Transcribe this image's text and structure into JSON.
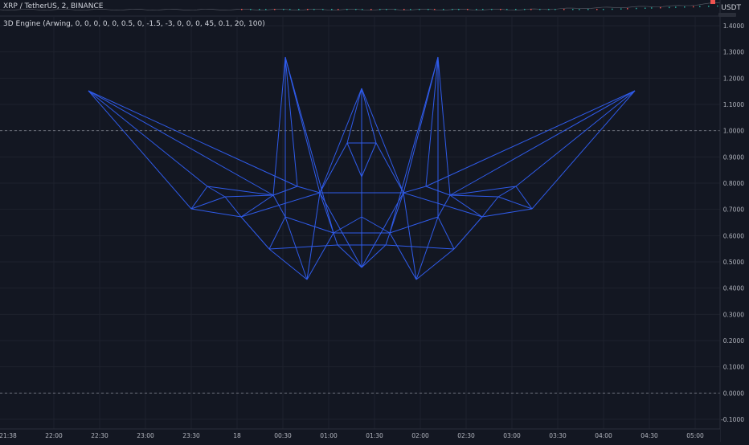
{
  "header": {
    "symbol_title": "XRP / TetherUS, 2, BINANCE",
    "unit": "USDT"
  },
  "indicator": {
    "title": "3D Engine (Arwing, 0, 0, 0, 0, 0, 0.5, 0, -1.5, -3, 0, 0, 0, 45, 0.1, 20, 100)"
  },
  "colors": {
    "background": "#131722",
    "grid": "#1e222d",
    "wireframe": "#2f5bea",
    "dashed_line": "#787b86",
    "axis_text": "#b2b5be",
    "mini_up": "#26a69a",
    "mini_down": "#ef5350"
  },
  "chart_data": {
    "type": "line",
    "y_axis_ticks": [
      "1.4000",
      "1.3000",
      "1.2000",
      "1.1000",
      "1.0000",
      "0.9000",
      "0.8000",
      "0.7000",
      "0.6000",
      "0.5000",
      "0.4000",
      "0.3000",
      "0.2000",
      "0.1000",
      "0.0000",
      "-0.1000"
    ],
    "ylim": [
      -0.1,
      1.4
    ],
    "x_axis_ticks": [
      "21:38",
      "22:00",
      "22:30",
      "23:00",
      "23:30",
      "18",
      "00:30",
      "01:00",
      "01:30",
      "02:00",
      "02:30",
      "03:00",
      "03:30",
      "04:00",
      "04:30",
      "05:00"
    ],
    "horizontal_dashed_lines": [
      1.0,
      0.0
    ]
  }
}
